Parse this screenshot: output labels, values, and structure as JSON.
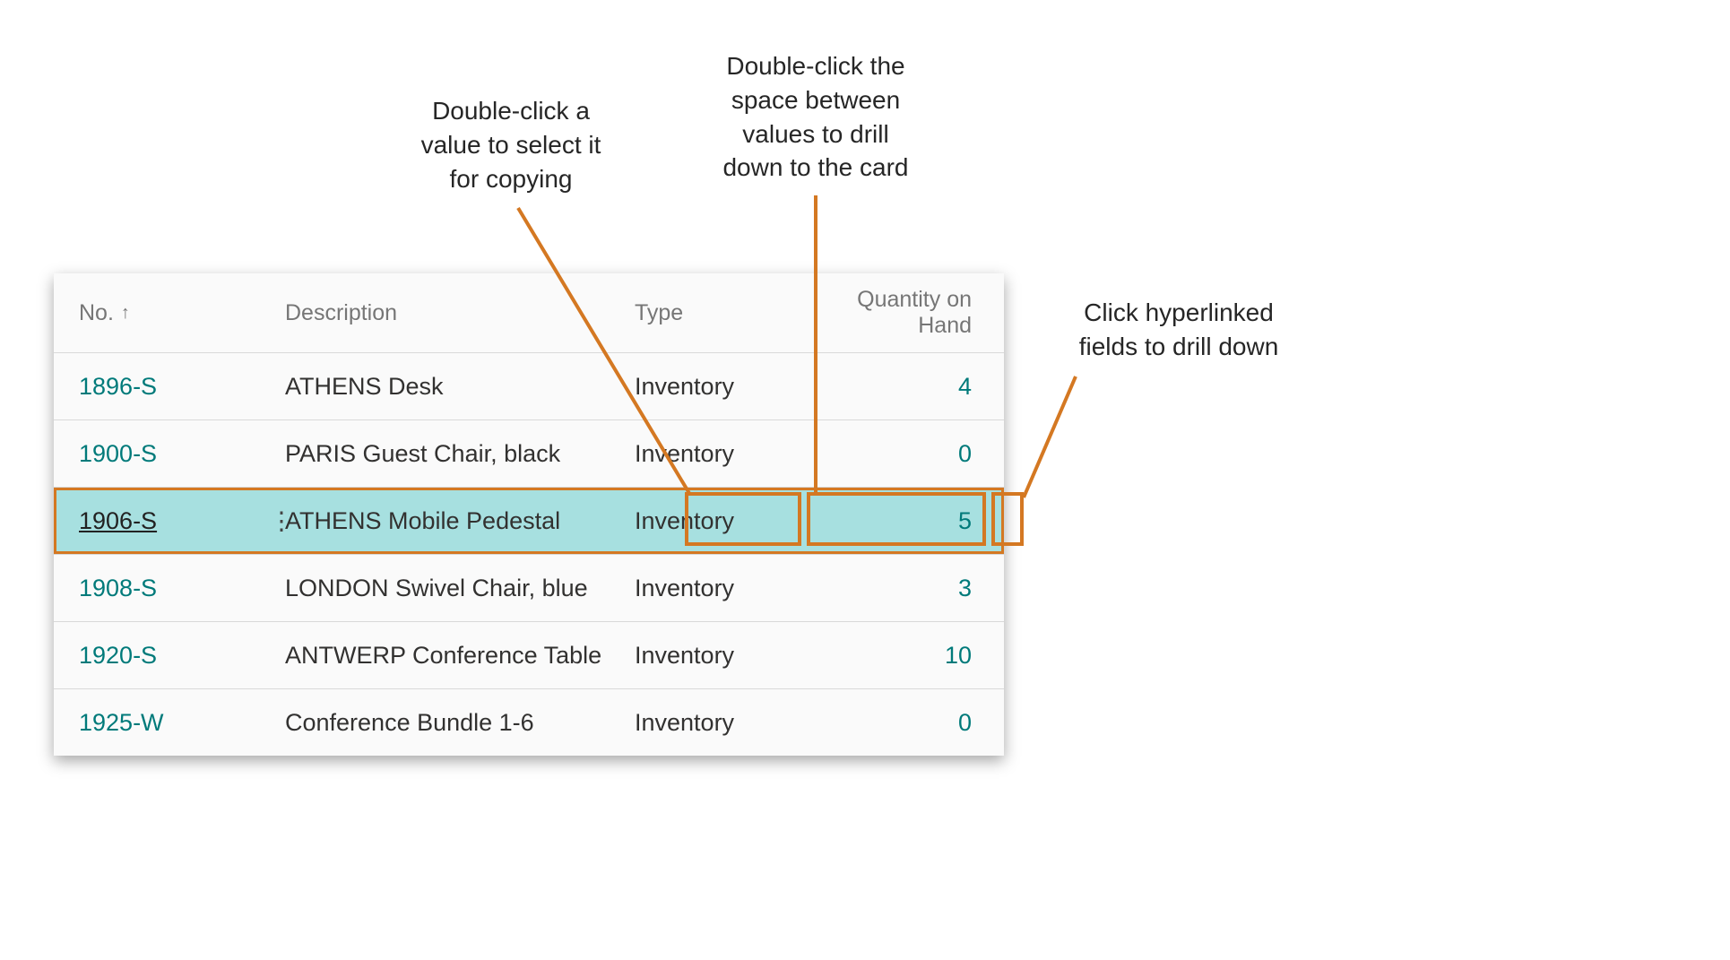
{
  "callouts": {
    "copy": "Double-click a\nvalue to select it\nfor copying",
    "drillspace": "Double-click the\nspace between\nvalues to drill\ndown to the card",
    "hyperlink": "Click hyperlinked\nfields to drill down"
  },
  "table": {
    "headers": {
      "no": "No.",
      "description": "Description",
      "type": "Type",
      "qty": "Quantity on Hand"
    },
    "sort_indicator": "↑",
    "rows": [
      {
        "no": "1896-S",
        "description": "ATHENS Desk",
        "type": "Inventory",
        "qty": "4",
        "selected": false
      },
      {
        "no": "1900-S",
        "description": "PARIS Guest Chair, black",
        "type": "Inventory",
        "qty": "0",
        "selected": false
      },
      {
        "no": "1906-S",
        "description": "ATHENS Mobile Pedestal",
        "type": "Inventory",
        "qty": "5",
        "selected": true
      },
      {
        "no": "1908-S",
        "description": "LONDON Swivel Chair, blue",
        "type": "Inventory",
        "qty": "3",
        "selected": false
      },
      {
        "no": "1920-S",
        "description": "ANTWERP Conference Table",
        "type": "Inventory",
        "qty": "10",
        "selected": false
      },
      {
        "no": "1925-W",
        "description": "Conference Bundle 1-6",
        "type": "Inventory",
        "qty": "0",
        "selected": false
      }
    ]
  },
  "icons": {
    "kebab": "⋮"
  },
  "colors": {
    "accent": "#007a7a",
    "highlight_bg": "#a7e0e0",
    "callout_line": "#d47822"
  }
}
